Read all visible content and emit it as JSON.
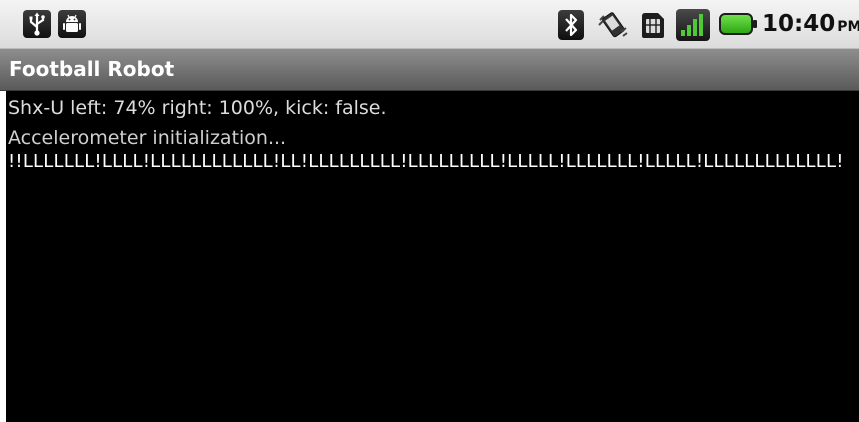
{
  "status_bar": {
    "left_icons": [
      "usb-icon",
      "android-icon"
    ],
    "right_icons": [
      "bluetooth-icon",
      "vibrate-icon",
      "sim-icon",
      "signal-icon",
      "battery-icon"
    ],
    "time": "10:40",
    "ampm": "PM",
    "battery_color": "#3ccb1e"
  },
  "title_bar": {
    "title": "Football Robot"
  },
  "content": {
    "status_line": "Shx-U left:  74% right: 100%, kick: false.",
    "accel_line": "Accelerometer initialization...",
    "data_line": "!!LLLLLLL!LLLL!LLLLLLLLLLLL!LL!LLLLLLLLL!LLLLLLLLL!LLLLL!LLLLLLL!LLLLL!LLLLLLLLLLLLL!"
  }
}
